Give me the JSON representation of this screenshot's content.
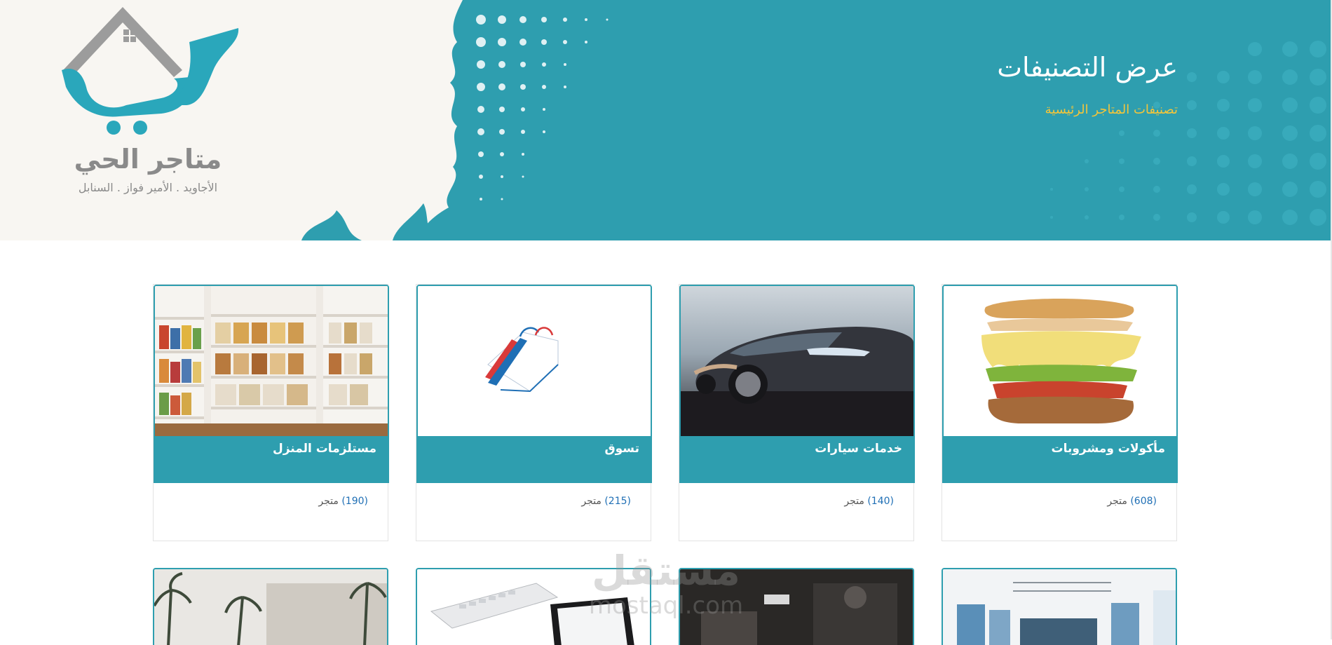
{
  "brand": {
    "name": "متاجر الحي",
    "tagline": "الأجاويد . الأمير فواز . السنابل"
  },
  "hero": {
    "title": "عرض التصنيفات",
    "subtitle": "تصنيفات المتاجر الرئيسية"
  },
  "categories": [
    {
      "title": "مأكولات ومشروبات",
      "count": "(608)",
      "unit": "متجر",
      "icon": "sandwich-image"
    },
    {
      "title": "خدمات سيارات",
      "count": "(140)",
      "unit": "متجر",
      "icon": "car-image"
    },
    {
      "title": "تسوق",
      "count": "(215)",
      "unit": "متجر",
      "icon": "shopping-bag-image"
    },
    {
      "title": "مستلزمات المنزل",
      "count": "(190)",
      "unit": "متجر",
      "icon": "pantry-shelves-image"
    }
  ],
  "watermark": {
    "arabic": "مستقل",
    "latin": "mostaql.com"
  },
  "colors": {
    "teal": "#2e9eaf",
    "gold": "#f3c53a",
    "count_blue": "#1f6fb5",
    "cream": "#f8f6f2"
  }
}
